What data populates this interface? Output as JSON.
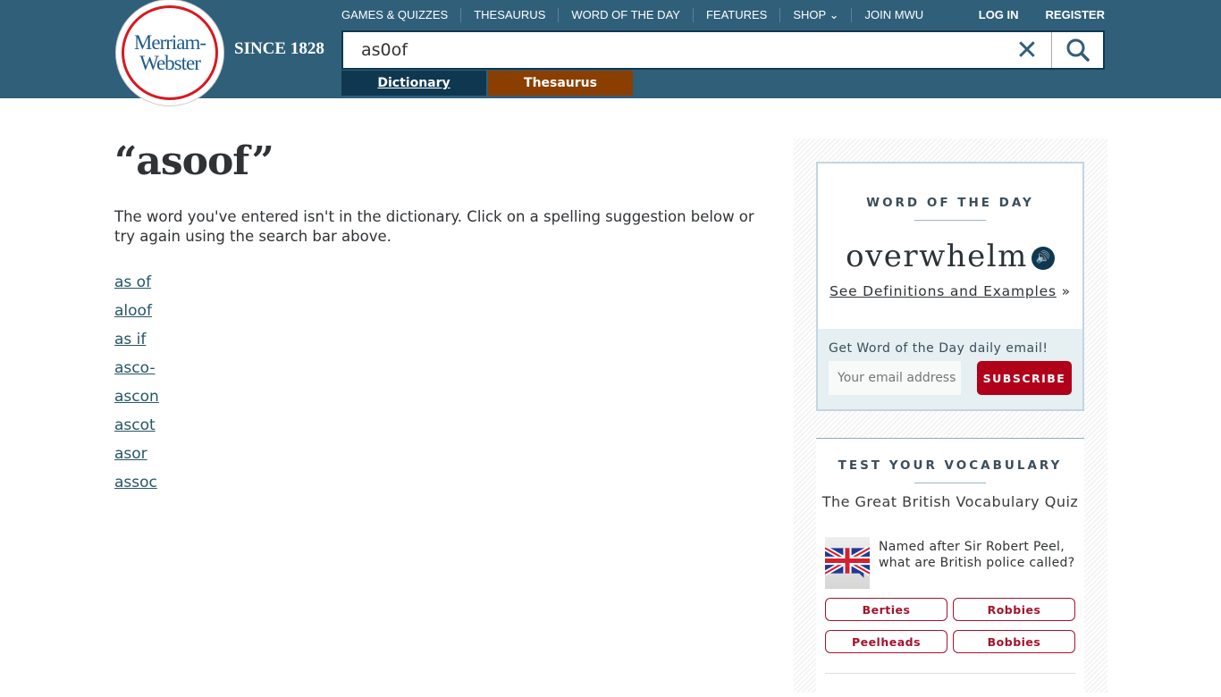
{
  "header": {
    "logo_text": [
      "Merriam-",
      "Webster"
    ],
    "since": "SINCE 1828",
    "nav": [
      "GAMES & QUIZZES",
      "THESAURUS",
      "WORD OF THE DAY",
      "FEATURES",
      "SHOP ⌄",
      "JOIN MWU"
    ],
    "login": "LOG IN",
    "register": "REGISTER",
    "search_value": "as0of",
    "clear_icon": "✕",
    "tabs": {
      "dictionary": "Dictionary",
      "thesaurus": "Thesaurus"
    }
  },
  "main": {
    "title": "“asoof”",
    "message": "The word you've entered isn't in the dictionary. Click on a spelling suggestion below or try again using the search bar above.",
    "suggestions": [
      "as of",
      "aloof",
      "as if",
      "asco-",
      "ascon",
      "ascot",
      "asor",
      "assoc"
    ]
  },
  "wod": {
    "caption": "WORD OF THE DAY",
    "word": "overwhelm",
    "link": "See Definitions and Examples",
    "link_suffix": " »",
    "email_prompt": "Get Word of the Day daily email!",
    "email_placeholder": "Your email address",
    "subscribe": "SUBSCRIBE"
  },
  "vocab": {
    "caption": "TEST YOUR VOCABULARY",
    "quiz_title": "The Great British Vocabulary Quiz",
    "question": "Named after Sir Robert Peel, what are British police called?",
    "answers": [
      "Berties",
      "Robbies",
      "Peelheads",
      "Bobbies"
    ]
  },
  "colors": {
    "header": "#305f7a",
    "dictionary_tab": "#0f3850",
    "thesaurus_tab": "#8a3e00",
    "subscribe": "#b0001a"
  }
}
